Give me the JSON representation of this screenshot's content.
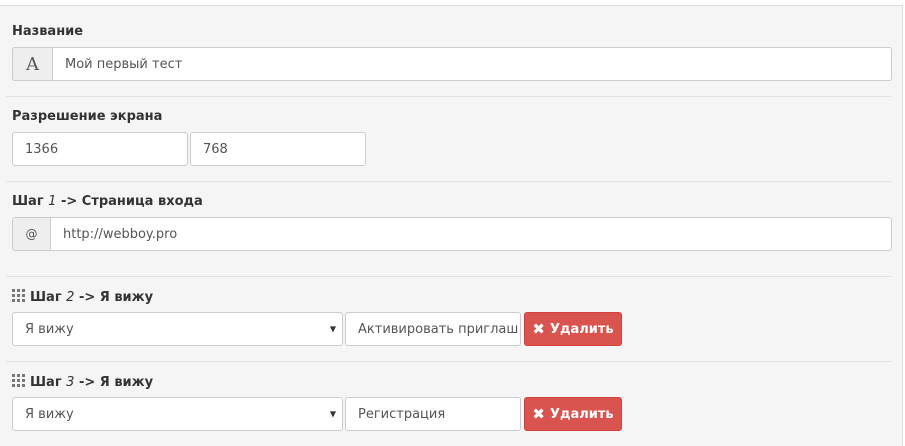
{
  "name_section": {
    "label": "Название",
    "icon_glyph": "A",
    "value": "Мой первый тест"
  },
  "resolution_section": {
    "label": "Разрешение экрана",
    "width": "1366",
    "height": "768"
  },
  "step1": {
    "prefix": "Шаг",
    "number": "1",
    "suffix": "-> Страница входа",
    "icon_glyph": "@",
    "url": "http://webboy.pro"
  },
  "step2": {
    "prefix": "Шаг",
    "number": "2",
    "suffix": "-> Я вижу",
    "select_value": "Я вижу",
    "text_value": "Активировать приглаш",
    "delete_label": "Удалить"
  },
  "step3": {
    "prefix": "Шаг",
    "number": "3",
    "suffix": "-> Я вижу",
    "select_value": "Я вижу",
    "text_value": "Регистрация",
    "delete_label": "Удалить"
  },
  "icons": {
    "drag_handle": "grid-icon",
    "delete": "times-icon",
    "caret": "caret-down-icon"
  },
  "colors": {
    "panel_bg": "#f5f5f5",
    "danger": "#d9534f",
    "border": "#cccccc"
  }
}
